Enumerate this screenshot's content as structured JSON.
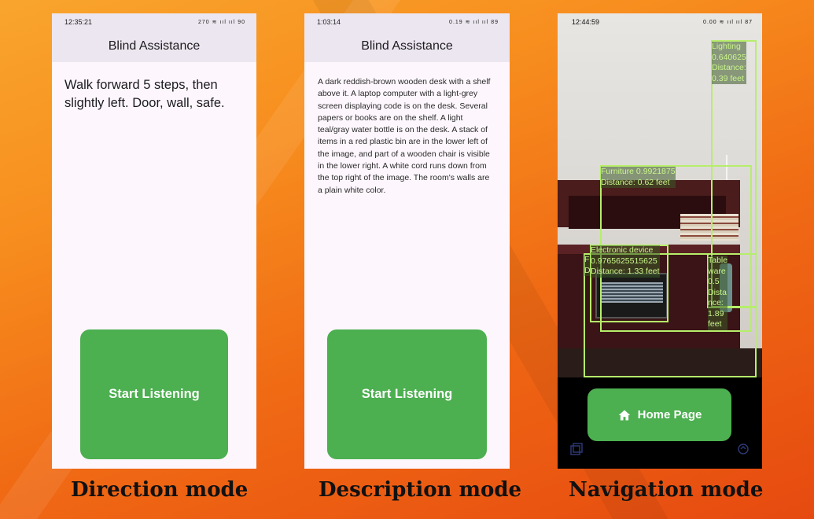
{
  "colors": {
    "accent_green": "#4caf50",
    "box_green": "#b6ee6a",
    "appbar_bg": "#ece6f0"
  },
  "direction": {
    "time": "12:35:21",
    "status_icons": "270 ≋ ııl ııl 90",
    "title": "Blind Assistance",
    "text": "Walk forward 5 steps, then slightly left.  Door, wall,  safe.",
    "button": "Start Listening",
    "caption": "Direction mode"
  },
  "description": {
    "time": "1:03:14",
    "status_icons": "0.19 ≋ ııl ııl 89",
    "title": "Blind Assistance",
    "text": "A dark reddish-brown wooden desk with a shelf above it.  A laptop computer with a light-grey screen displaying code is on the desk.  Several papers or books are on the shelf.  A light teal/gray water bottle is on the desk.  A stack of items in a red plastic bin are in the lower left of the image, and part of a wooden chair is visible in the lower right.  A white cord runs down from the top right of the image. The room's walls are a plain white color.",
    "button": "Start Listening",
    "caption": "Description mode"
  },
  "navigation": {
    "time": "12:44:59",
    "status_icons": "0.00 ≋ ııl ııl 87",
    "detections": [
      {
        "label": "Lighting\n0.640625\nDistance:\n0.39 feet"
      },
      {
        "label": "Furniture 0.9921875\nDistance: 0.62 feet"
      },
      {
        "label": "Electronic device\n0.9765625515625\nDistance: 1.33 feet"
      },
      {
        "label": "Table\nware\n0.5\nDista\nnce:\n1.89\nfeet"
      },
      {
        "label": "F\nD"
      }
    ],
    "button": "Home Page",
    "caption": "Navigation mode"
  }
}
